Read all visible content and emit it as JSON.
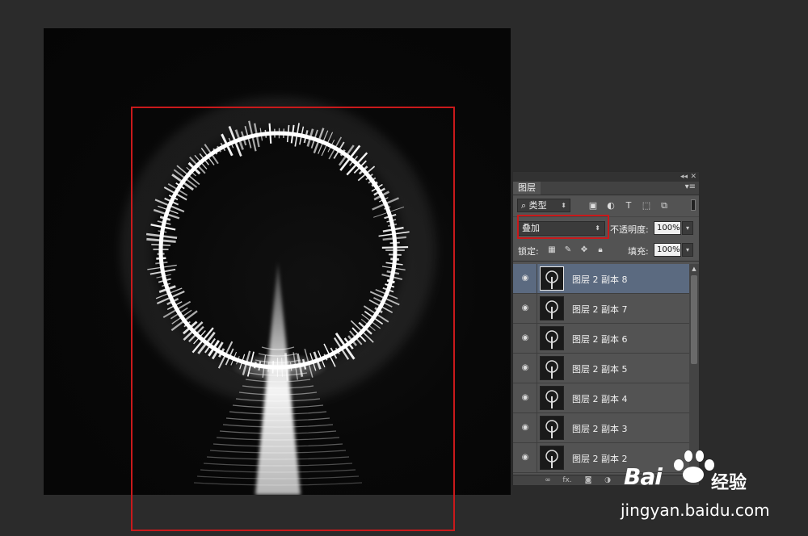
{
  "layers_panel": {
    "collapse_icon": "double-chevron-left",
    "close_icon": "close-x",
    "tab_label": "图层",
    "menu_icon": "panel-menu",
    "filter": {
      "kind_label": "类型",
      "search_icon": "search-magnifier",
      "filter_icons": [
        "image-filter-icon",
        "adjustment-filter-icon",
        "type-filter-icon",
        "shape-filter-icon",
        "smart-object-filter-icon"
      ]
    },
    "blend_mode": "叠加",
    "opacity_label": "不透明度:",
    "opacity_value": "100%",
    "lock_label": "锁定:",
    "fill_label": "填充:",
    "fill_value": "100%",
    "layers": [
      {
        "name": "图层 2 副本 8",
        "selected": true
      },
      {
        "name": "图层 2 副本 7",
        "selected": false
      },
      {
        "name": "图层 2 副本 6",
        "selected": false
      },
      {
        "name": "图层 2 副本 5",
        "selected": false
      },
      {
        "name": "图层 2 副本 4",
        "selected": false
      },
      {
        "name": "图层 2 副本 3",
        "selected": false
      },
      {
        "name": "图层 2 副本 2",
        "selected": false
      }
    ],
    "bottom_icons": [
      "link-icon",
      "fx-icon",
      "mask-icon",
      "adjustment-icon"
    ],
    "fx_label": "fx."
  },
  "watermark": {
    "brand": "Bai",
    "brand_cn": "经验",
    "url": "jingyan.baidu.com"
  },
  "colors": {
    "app_bg": "#2b2b2b",
    "panel_bg": "#535353",
    "selected_row": "#5b6a80",
    "highlight_red": "#c9191b"
  }
}
